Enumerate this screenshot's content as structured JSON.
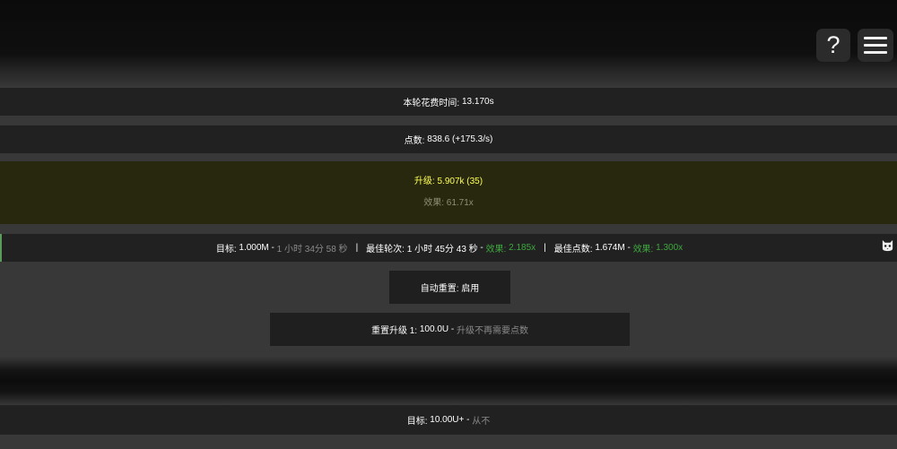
{
  "header": {
    "help_icon_text": "?",
    "help_icon": "question-mark-icon",
    "menu_icon": "hamburger-menu-icon"
  },
  "round_time": {
    "label": "本轮花费时间: ",
    "value": "13.170s"
  },
  "points": {
    "label": "点数: ",
    "value": "838.6 (+175.3/s)"
  },
  "upgrade": {
    "label": "升级: ",
    "value": "5.907k (35)",
    "effect_label": "效果: ",
    "effect_value": "61.71x",
    "bg_color": "#28280f",
    "text_color": "#ffff55"
  },
  "goal": {
    "label": "目标: ",
    "value": "1.000M",
    "dash": " - ",
    "eta": "1 小时 34分 58 秒",
    "separator": "|",
    "best_round_label": "最佳轮次: ",
    "best_round_value": "1 小时 45分 43 秒",
    "best_round_effect_label": "效果: ",
    "best_round_effect_value": "2.185x",
    "best_points_label": "最佳点数: ",
    "best_points_value": "1.674M",
    "best_points_effect_label": "效果: ",
    "best_points_effect_value": "1.300x",
    "icon": "cat-face-icon",
    "accent_color": "#3ea83e"
  },
  "auto_reset": {
    "label": "自动重置: ",
    "value": "启用"
  },
  "reset_upgrade": {
    "label": "重置升级 1: ",
    "value": "100.0U",
    "dash": " - ",
    "desc": "升级不再需要点数"
  },
  "target": {
    "label": "目标: ",
    "value": "10.00U+",
    "dash": " - ",
    "desc": "从不"
  }
}
